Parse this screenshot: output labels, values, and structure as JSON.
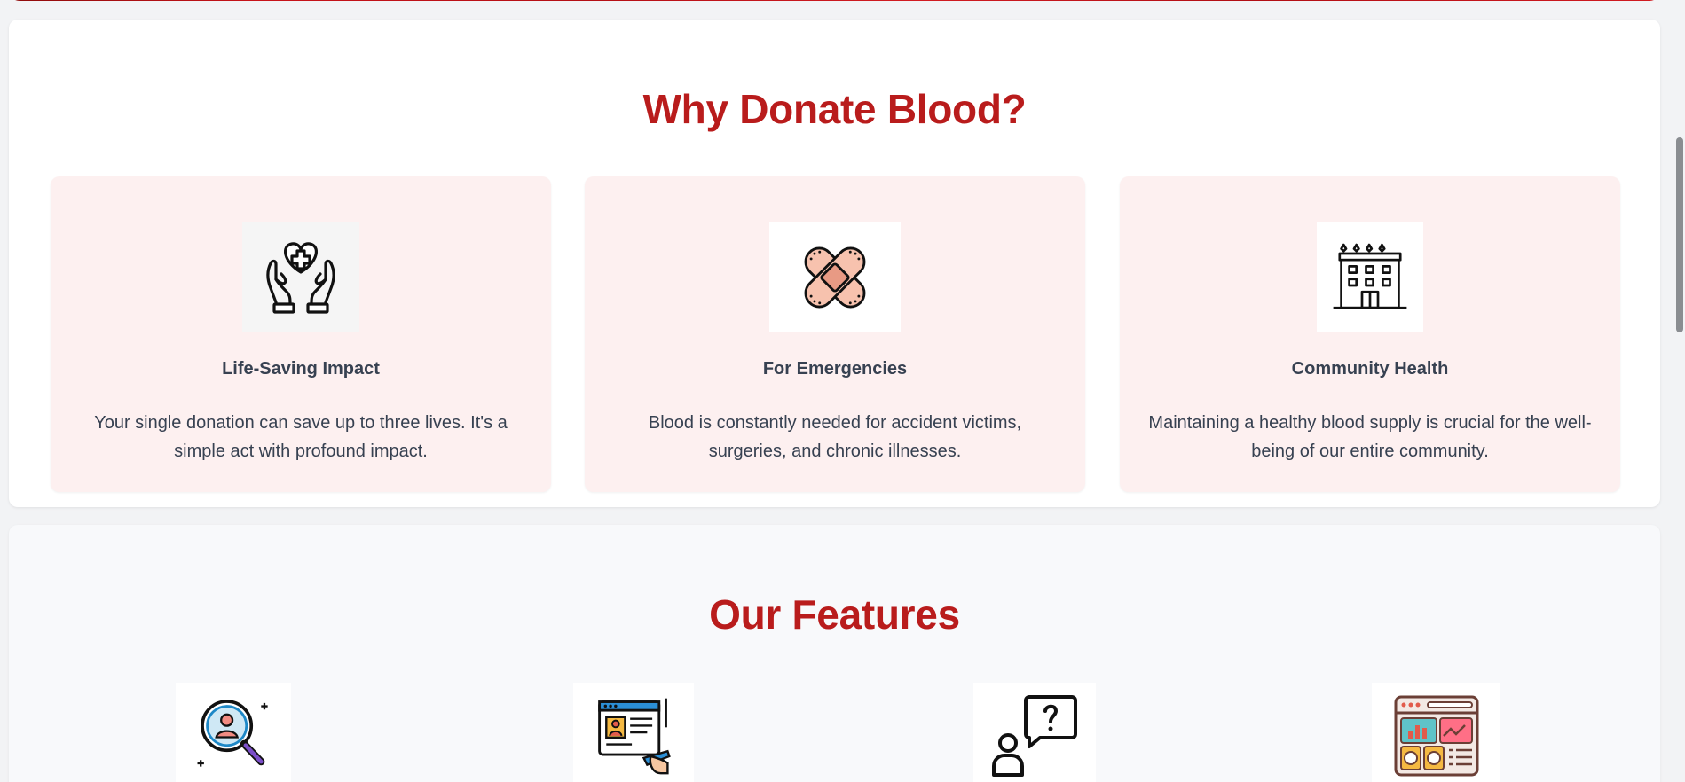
{
  "why": {
    "title": "Why Donate Blood?",
    "cards": [
      {
        "icon": "heart-hands-icon",
        "title": "Life-Saving Impact",
        "text": "Your single donation can save up to three lives. It's a simple act with profound impact."
      },
      {
        "icon": "bandage-icon",
        "title": "For Emergencies",
        "text": "Blood is constantly needed for accident victims, surgeries, and chronic illnesses."
      },
      {
        "icon": "hospital-building-icon",
        "title": "Community Health",
        "text": "Maintaining a healthy blood supply is crucial for the well-being of our entire community."
      }
    ]
  },
  "features": {
    "title": "Our Features",
    "icons": [
      "donor-search-icon",
      "registration-form-icon",
      "help-question-icon",
      "dashboard-icon"
    ]
  },
  "colors": {
    "accent": "#b91c1c",
    "card_bg": "#fdf0f0",
    "text": "#374151"
  }
}
